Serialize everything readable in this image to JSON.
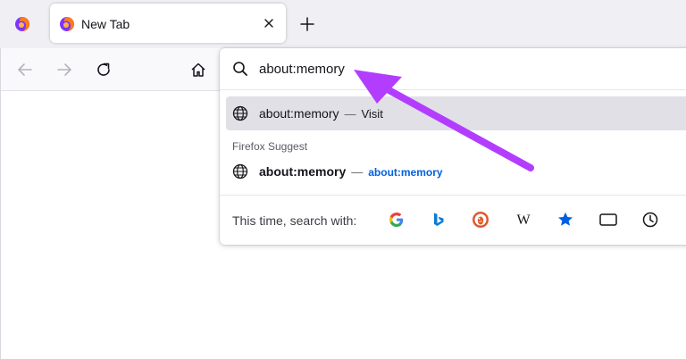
{
  "tab": {
    "title": "New Tab"
  },
  "urlbar": {
    "value": "about:memory"
  },
  "results": {
    "first": {
      "title": "about:memory",
      "separator": "—",
      "action": "Visit"
    },
    "group_label": "Firefox Suggest",
    "suggest": {
      "title": "about:memory",
      "separator": "—",
      "url": "about:memory"
    }
  },
  "one_offs": {
    "label": "This time, search with:",
    "engines": [
      "google-icon",
      "bing-icon",
      "duckduckgo-icon",
      "wikipedia-icon",
      "bookmarks-star-icon",
      "tabs-icon",
      "history-icon"
    ]
  },
  "colors": {
    "accent": "#0061e0",
    "arrow": "#b33dff",
    "selected_row": "#e0e0e6"
  }
}
